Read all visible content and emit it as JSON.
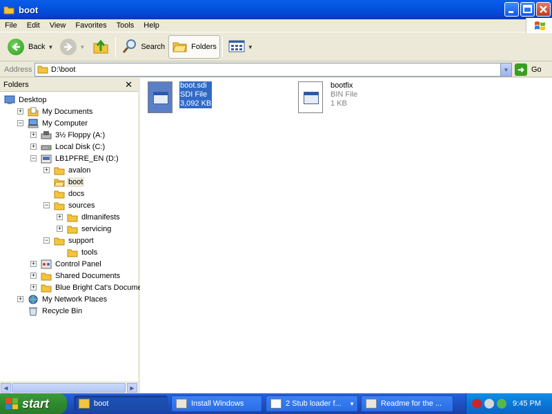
{
  "window": {
    "title": "boot"
  },
  "menu": [
    "File",
    "Edit",
    "View",
    "Favorites",
    "Tools",
    "Help"
  ],
  "toolbar": {
    "back": "Back",
    "search": "Search",
    "folders": "Folders"
  },
  "address": {
    "label": "Address",
    "path": "D:\\boot",
    "go": "Go"
  },
  "folders_pane": {
    "title": "Folders",
    "tree": [
      {
        "label": "Desktop",
        "depth": 0,
        "expander": "none",
        "icon": "desktop-icon"
      },
      {
        "label": "My Documents",
        "depth": 1,
        "expander": "+",
        "icon": "my-documents-icon"
      },
      {
        "label": "My Computer",
        "depth": 1,
        "expander": "-",
        "icon": "my-computer-icon"
      },
      {
        "label": "3½ Floppy (A:)",
        "depth": 2,
        "expander": "+",
        "icon": "floppy-drive-icon"
      },
      {
        "label": "Local Disk (C:)",
        "depth": 2,
        "expander": "+",
        "icon": "hard-disk-icon"
      },
      {
        "label": "LB1PFRE_EN (D:)",
        "depth": 2,
        "expander": "-",
        "icon": "cd-drive-icon"
      },
      {
        "label": "avalon",
        "depth": 3,
        "expander": "+",
        "icon": "folder-icon"
      },
      {
        "label": "boot",
        "depth": 3,
        "expander": "none",
        "icon": "folder-open-icon",
        "selected": true
      },
      {
        "label": "docs",
        "depth": 3,
        "expander": "none",
        "icon": "folder-icon"
      },
      {
        "label": "sources",
        "depth": 3,
        "expander": "-",
        "icon": "folder-icon"
      },
      {
        "label": "dlmanifests",
        "depth": 4,
        "expander": "+",
        "icon": "folder-icon"
      },
      {
        "label": "servicing",
        "depth": 4,
        "expander": "+",
        "icon": "folder-icon"
      },
      {
        "label": "support",
        "depth": 3,
        "expander": "-",
        "icon": "folder-icon"
      },
      {
        "label": "tools",
        "depth": 4,
        "expander": "none",
        "icon": "folder-icon"
      },
      {
        "label": "Control Panel",
        "depth": 2,
        "expander": "+",
        "icon": "control-panel-icon"
      },
      {
        "label": "Shared Documents",
        "depth": 2,
        "expander": "+",
        "icon": "folder-icon"
      },
      {
        "label": "Blue Bright Cat's Documents",
        "depth": 2,
        "expander": "+",
        "icon": "folder-icon"
      },
      {
        "label": "My Network Places",
        "depth": 1,
        "expander": "+",
        "icon": "network-places-icon"
      },
      {
        "label": "Recycle Bin",
        "depth": 1,
        "expander": "none",
        "icon": "recycle-bin-icon"
      }
    ]
  },
  "files": [
    {
      "name": "boot.sdi",
      "type": "SDI File",
      "size": "3,092 KB",
      "selected": true
    },
    {
      "name": "bootfix",
      "type": "BIN File",
      "size": "1 KB",
      "selected": false
    }
  ],
  "taskbar": {
    "start": "start",
    "tasks": [
      {
        "label": "boot",
        "active": true
      },
      {
        "label": "Install Windows",
        "active": false
      },
      {
        "label": "2 Stub loader f...",
        "active": false
      },
      {
        "label": "Readme for the ...",
        "active": false
      }
    ],
    "clock": "9:45 PM"
  },
  "colors": {
    "titlebar": "#0553e0",
    "selection": "#316ac5",
    "taskbar": "#245edb",
    "start": "#3c9a3c"
  }
}
